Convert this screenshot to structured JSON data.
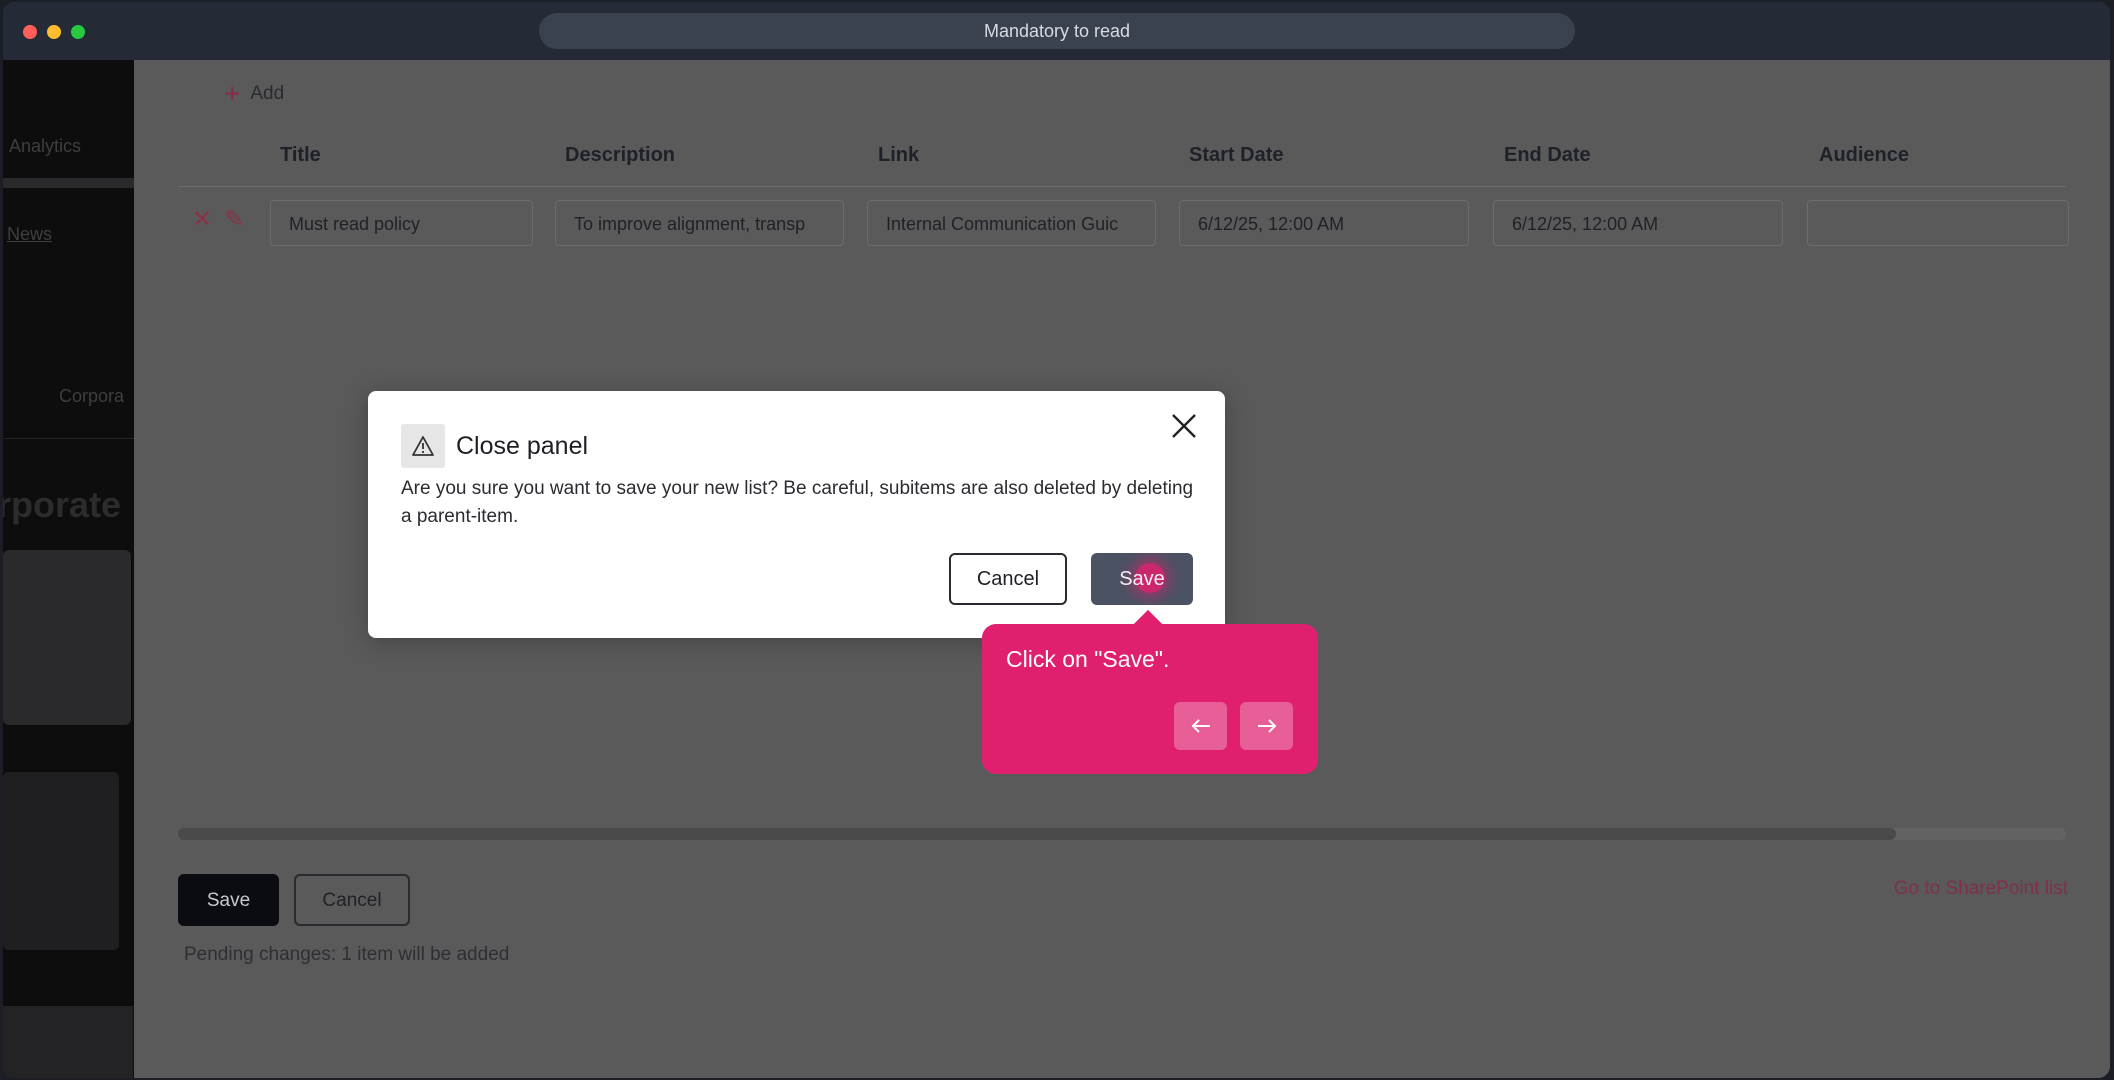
{
  "window": {
    "title": "Mandatory to read"
  },
  "background_page": {
    "sidebar_texts": [
      "Analytics",
      "News",
      "Corpora",
      "rporate"
    ]
  },
  "toolbar": {
    "add_label": "Add"
  },
  "table": {
    "columns": [
      "Title",
      "Description",
      "Link",
      "Start Date",
      "End Date",
      "Audience"
    ],
    "rows": [
      {
        "title": "Must read policy",
        "description": "To improve alignment, transp",
        "link": "Internal Communication Guic",
        "start_date": "6/12/25, 12:00 AM",
        "end_date": "6/12/25, 12:00 AM",
        "audience": ""
      }
    ],
    "horizontal_scroll_fraction": 0.91
  },
  "footer": {
    "save_label": "Save",
    "cancel_label": "Cancel",
    "sharepoint_link": "Go to SharePoint list",
    "pending_text": "Pending changes: 1 item will be added"
  },
  "dialog": {
    "title": "Close panel",
    "message": "Are you sure you want to save your new list? Be careful, subitems are also deleted by deleting a parent-item.",
    "cancel_label": "Cancel",
    "save_label": "Save",
    "icon": "warning-icon"
  },
  "tooltip": {
    "text": "Click on \"Save\".",
    "accent_color": "#e0206e"
  }
}
